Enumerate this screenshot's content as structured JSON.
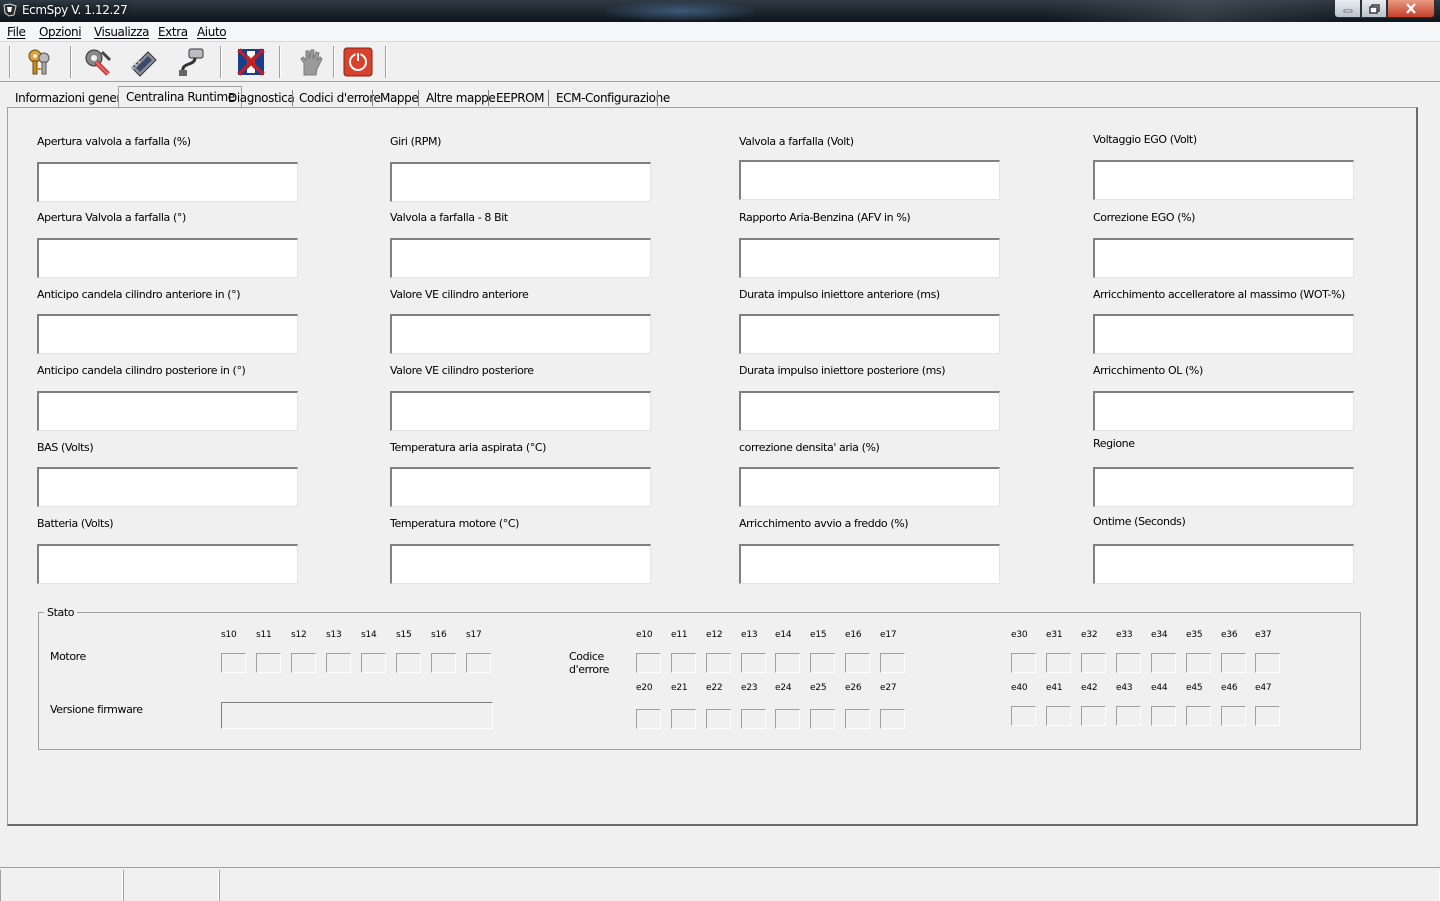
{
  "window": {
    "title": "EcmSpy V. 1.12.27"
  },
  "menu": [
    "File",
    "Opzioni",
    "Visualizza",
    "Extra",
    "Aiuto"
  ],
  "toolbar": [
    "keys-icon",
    "settings-wrench-icon",
    "ecm-chip-icon",
    "cable-connector-icon",
    "flag-icon",
    "hand-icon",
    "power-icon"
  ],
  "tabs": [
    "Informazioni generali",
    "Centralina Runtime",
    "Diagnostica",
    "Codici d'errore",
    "Mappe",
    "Altre mappe",
    "EEPROM",
    "ECM-Configurazione"
  ],
  "active_tab": 1,
  "fields": {
    "col1": [
      "Apertura valvola a farfalla (%)",
      "Apertura Valvola a farfalla (°)",
      "Anticipo candela cilindro anteriore in (°)",
      "Anticipo candela cilindro posteriore in (°)",
      "BAS (Volts)",
      "Batteria (Volts)"
    ],
    "col2": [
      "Giri (RPM)",
      "Valvola a farfalla - 8 Bit",
      "Valore VE cilindro anteriore",
      "Valore VE cilindro posteriore",
      "Temperatura aria aspirata (°C)",
      "Temperatura motore (°C)"
    ],
    "col3": [
      "Valvola a farfalla (Volt)",
      "Rapporto Aria-Benzina (AFV in %)",
      "Durata impulso iniettore anteriore (ms)",
      "Durata impulso iniettore posteriore (ms)",
      "correzione densita' aria (%)",
      "Arricchimento avvio a freddo (%)"
    ],
    "col4": [
      "Voltaggio EGO (Volt)",
      "Correzione EGO (%)",
      "Arricchimento accelleratore al massimo (WOT-%)",
      "Arricchimento OL (%)",
      "Regione",
      "Ontime (Seconds)"
    ]
  },
  "stato": {
    "title": "Stato",
    "motore_label": "Motore",
    "firmware_label": "Versione firmware",
    "codice_label_1": "Codice",
    "codice_label_2": "d'errore",
    "s_labels": [
      "s10",
      "s11",
      "s12",
      "s13",
      "s14",
      "s15",
      "s16",
      "s17"
    ],
    "e1x": [
      "e10",
      "e11",
      "e12",
      "e13",
      "e14",
      "e15",
      "e16",
      "e17"
    ],
    "e2x": [
      "e20",
      "e21",
      "e22",
      "e23",
      "e24",
      "e25",
      "e26",
      "e27"
    ],
    "e3x": [
      "e30",
      "e31",
      "e32",
      "e33",
      "e34",
      "e35",
      "e36",
      "e37"
    ],
    "e4x": [
      "e40",
      "e41",
      "e42",
      "e43",
      "e44",
      "e45",
      "e46",
      "e47"
    ]
  }
}
